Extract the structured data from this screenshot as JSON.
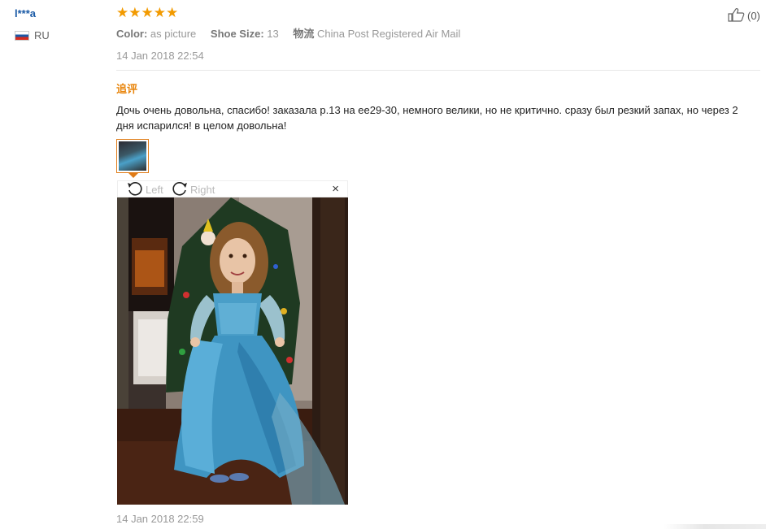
{
  "buyer": {
    "name": "l***a",
    "country": "RU"
  },
  "review": {
    "stars": "★★★★★",
    "rating": 5,
    "color_label": "Color:",
    "color_value": "as picture",
    "size_label": "Shoe Size:",
    "size_value": "13",
    "shipping_label": "物流",
    "shipping_value": "China Post Registered Air Mail",
    "date": "14 Jan 2018 22:54",
    "helpful_count": "(0)"
  },
  "followup": {
    "label": "追评",
    "text": "Дочь очень довольна, спасибо! заказала р.13 на ее29-30, немного велики, но не критично. сразу был резкий запах, но через 2 дня испарился! в целом довольна!",
    "date": "14 Jan 2018 22:59"
  },
  "viewer": {
    "rotate_left": "Left",
    "rotate_right": "Right",
    "close": "×"
  },
  "colors": {
    "star": "#f29a00",
    "accent": "#e07c17",
    "link": "#1a5aa6",
    "dress": "#4aa0c8"
  },
  "icons": {
    "rotate_left": "rotate-left-icon",
    "rotate_right": "rotate-right-icon",
    "thumbs_up": "thumbs-up-icon",
    "flag": "flag-ru-icon"
  }
}
